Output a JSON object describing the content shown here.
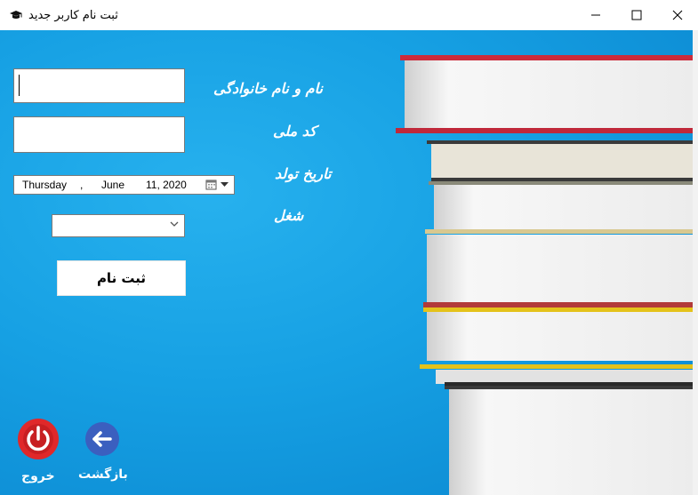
{
  "window": {
    "title": "ثبت نام کاربر جدید",
    "icon": "graduation-cap-icon"
  },
  "controls": {
    "minimize": "minimize-icon",
    "maximize": "maximize-icon",
    "close": "close-icon"
  },
  "form": {
    "fullname_label": "نام و نام خانوادگی",
    "national_code_label": "کد ملی",
    "birthdate_label": "تاریخ تولد",
    "job_label": "شغل",
    "fullname_value": "",
    "national_code_value": "",
    "birthdate": {
      "weekday": "Thursday",
      "sep": ",",
      "month": "June",
      "day_year": "11, 2020"
    },
    "job_value": "",
    "submit_label": "ثبت نام"
  },
  "footer": {
    "exit_label": "خروج",
    "back_label": "بازگشت"
  },
  "colors": {
    "background": "#16a0e3",
    "exit": "#e0282a",
    "back": "#3b5fbf"
  }
}
